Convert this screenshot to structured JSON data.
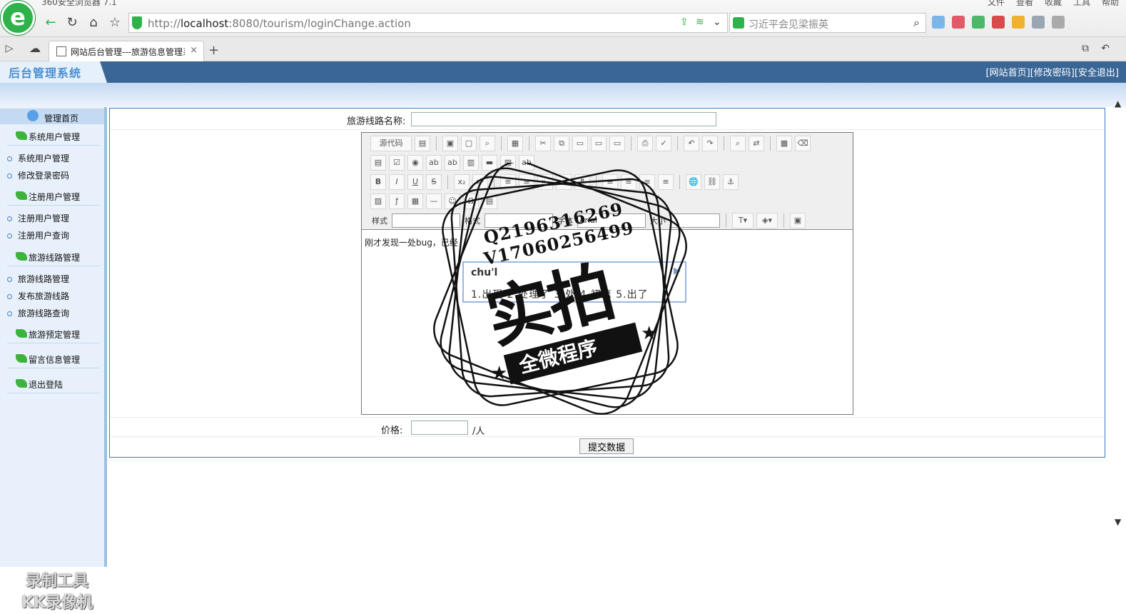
{
  "browser": {
    "app_title": "360安全浏览器 7.1",
    "menu": [
      "文件",
      "查看",
      "收藏",
      "工具",
      "帮助"
    ],
    "url_prefix": "http://",
    "url_host": "localhost",
    "url_rest": ":8080/tourism/loginChange.action",
    "search_text": "习近平会见梁振英",
    "tab_title": "网站后台管理---旅游信息管理系统",
    "tab_close": "×",
    "new_tab": "+"
  },
  "admin": {
    "logo": "后台管理系统",
    "links": [
      "[网站首页]",
      "[修改密码]",
      "[安全退出]"
    ]
  },
  "sidebar": {
    "home": "管理首页",
    "sections": [
      {
        "label": "系统用户管理",
        "items": [
          "系统用户管理",
          "修改登录密码"
        ]
      },
      {
        "label": "注册用户管理",
        "items": [
          "注册用户管理",
          "注册用户查询"
        ]
      },
      {
        "label": "旅游线路管理",
        "items": [
          "旅游线路管理",
          "发布旅游线路",
          "旅游线路查询"
        ]
      },
      {
        "label": "旅游预定管理",
        "items": []
      },
      {
        "label": "留言信息管理",
        "items": []
      },
      {
        "label": "退出登陆",
        "items": []
      }
    ]
  },
  "form": {
    "route_name_label": "旅游线路名称:",
    "route_name_value": "",
    "price_label": "价格:",
    "price_value": "",
    "price_unit": "/人",
    "submit_label": "提交数据"
  },
  "editor": {
    "source_button": "源代码",
    "style_label": "样式",
    "format_label": "格式",
    "font_label": "字体",
    "font_value": "Arial",
    "size_label": "大小",
    "content": "刚才发现一处bug，已经"
  },
  "ime": {
    "input": "chu'l",
    "candidates": "1.出现 2.处理了 3.处 4.初恋 5.出了"
  },
  "watermarks": {
    "recorder_line1": "录制工具",
    "recorder_line2": "KK录像机",
    "stamp_q": "Q2196316269",
    "stamp_v": "V17060256499",
    "stamp_big": "实拍",
    "stamp_band": "全微程序"
  }
}
